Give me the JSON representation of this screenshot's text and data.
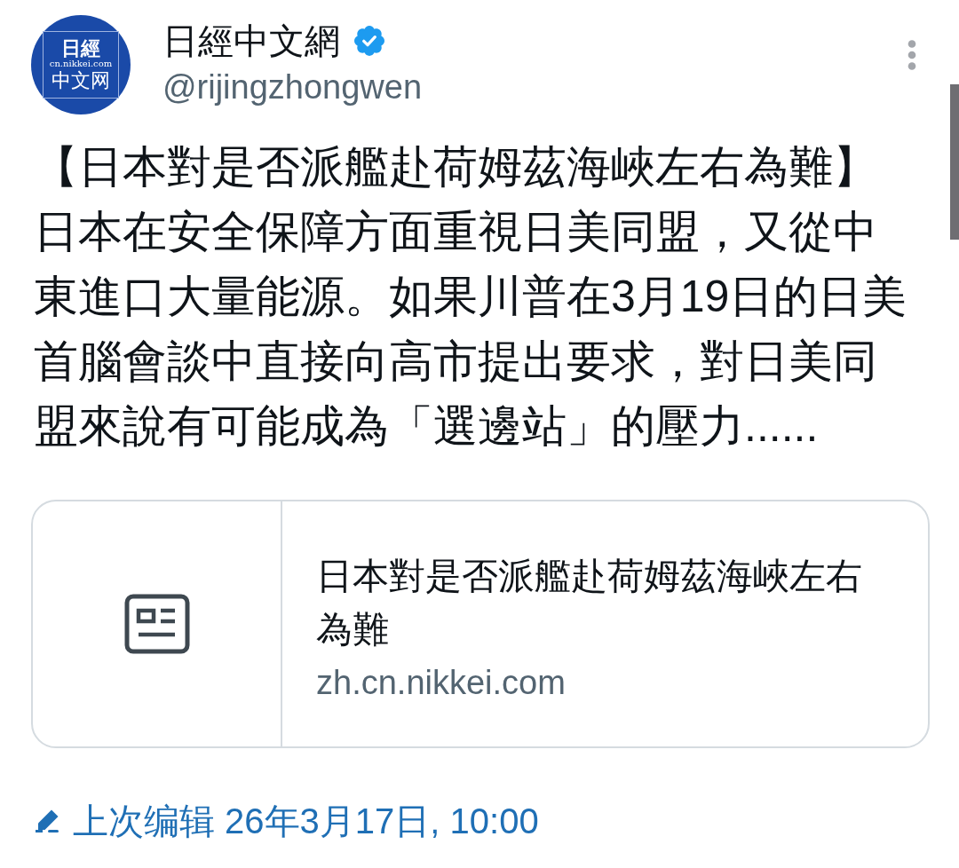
{
  "author": {
    "avatar": {
      "logo_title": "日經",
      "logo_url": "cn.nikkei.com",
      "logo_subtitle": "中文网"
    },
    "name": "日經中文網",
    "verified": true,
    "handle": "@rijingzhongwen"
  },
  "post": {
    "headline": "【日本對是否派艦赴荷姆茲海峽左右為難】",
    "text": "日本在安全保障方面重視日美同盟，又從中東進口大量能源。如果川普在3月19日的日美首腦會談中直接向高市提出要求，對日美同盟來說有可能成為「選邊站」的壓力......"
  },
  "link_card": {
    "title": "日本對是否派艦赴荷姆茲海峽左右為難",
    "domain": "zh.cn.nikkei.com"
  },
  "edit_note": {
    "text": "上次编辑 26年3月17日, 10:00"
  }
}
